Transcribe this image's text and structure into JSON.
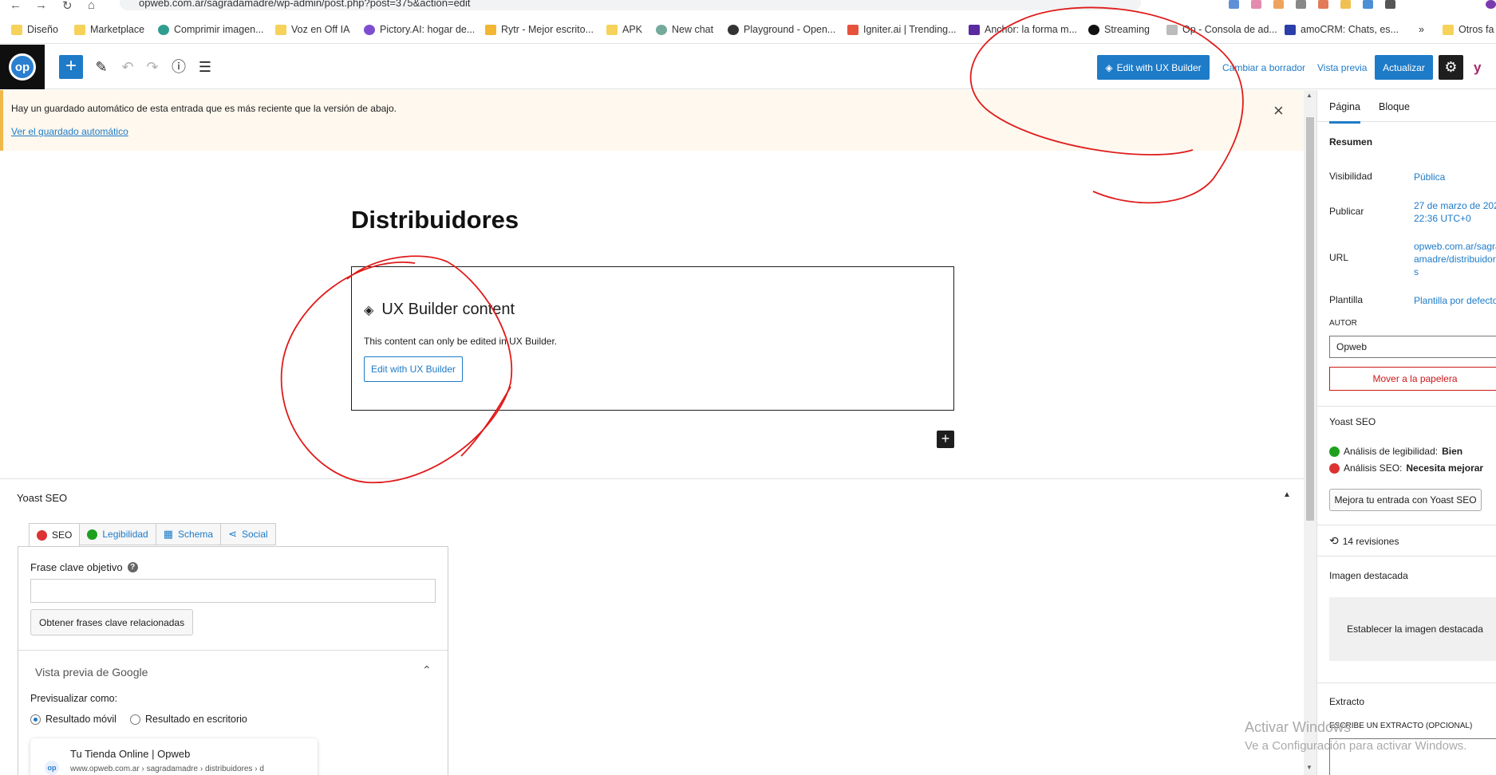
{
  "browser": {
    "url": "opweb.com.ar/sagradamadre/wp-admin/post.php?post=375&action=edit",
    "bookmarks": [
      {
        "label": "Diseño",
        "icon": "folder-icon"
      },
      {
        "label": "Marketplace",
        "icon": "folder-icon"
      },
      {
        "label": "Comprimir imagen...",
        "icon": "leaf-icon"
      },
      {
        "label": "Voz en Off IA",
        "icon": "folder-icon"
      },
      {
        "label": "Pictory.AI: hogar de...",
        "icon": "pictory-icon"
      },
      {
        "label": "Rytr - Mejor escrito...",
        "icon": "rytr-icon"
      },
      {
        "label": "APK",
        "icon": "folder-icon"
      },
      {
        "label": "New chat",
        "icon": "openai-icon"
      },
      {
        "label": "Playground - Open...",
        "icon": "openai-icon"
      },
      {
        "label": "Igniter.ai | Trending...",
        "icon": "igniter-icon"
      },
      {
        "label": "Anchor: la forma m...",
        "icon": "anchor-icon"
      },
      {
        "label": "Streaming",
        "icon": "streaming-icon"
      },
      {
        "label": "Op - Consola de ad...",
        "icon": "op-icon"
      },
      {
        "label": "amoCRM: Chats, es...",
        "icon": "amocrm-icon"
      },
      {
        "label": "»",
        "icon": "overflow-icon"
      },
      {
        "label": "Otros fa",
        "icon": "folder-icon"
      }
    ]
  },
  "toolbar": {
    "ux_builder_label": "Edit with UX Builder",
    "switch_draft_label": "Cambiar a borrador",
    "preview_label": "Vista previa",
    "update_label": "Actualizar",
    "logo_text": "op"
  },
  "notice": {
    "message": "Hay un guardado automático de esta entrada que es más reciente que la versión de abajo.",
    "link": "Ver el guardado automático"
  },
  "editor": {
    "title": "Distribuidores",
    "block": {
      "heading": "UX Builder content",
      "description": "This content can only be edited in UX Builder.",
      "button": "Edit with UX Builder"
    }
  },
  "yoast": {
    "box_title": "Yoast SEO",
    "tabs": [
      {
        "label": "SEO",
        "icon": "red-dot-icon"
      },
      {
        "label": "Legibilidad",
        "icon": "smiley-icon"
      },
      {
        "label": "Schema",
        "icon": "grid-icon"
      },
      {
        "label": "Social",
        "icon": "share-icon"
      }
    ],
    "focus_label": "Frase clave objetivo",
    "related_button": "Obtener frases clave relacionadas",
    "google_preview": "Vista previa de Google",
    "preview_as": "Previsualizar como:",
    "mobile_result": "Resultado móvil",
    "desktop_result": "Resultado en escritorio",
    "snippet_title": "Tu Tienda Online | Opweb",
    "snippet_url": "www.opweb.com.ar › sagradamadre › distribuidores › d"
  },
  "sidebar": {
    "tab_page": "Página",
    "tab_block": "Bloque",
    "summary": "Resumen",
    "visibility_label": "Visibilidad",
    "visibility_value": "Pública",
    "publish_label": "Publicar",
    "publish_value_1": "27 de marzo de 202",
    "publish_value_2": "22:36 UTC+0",
    "url_label": "URL",
    "url_value_1": "opweb.com.ar/sagra",
    "url_value_2": "amadre/distribuidor",
    "url_value_3": "s",
    "template_label": "Plantilla",
    "template_value": "Plantilla por defecto",
    "author_label": "AUTOR",
    "author_value": "Opweb",
    "trash": "Mover a la papelera",
    "yoast_title": "Yoast SEO",
    "readability_label": "Análisis de legibilidad:",
    "readability_value": "Bien",
    "seo_label": "Análisis SEO:",
    "seo_value": "Necesita mejorar",
    "improve_button": "Mejora tu entrada con Yoast SEO",
    "revisions": "14 revisiones",
    "featured_title": "Imagen destacada",
    "featured_button": "Establecer la imagen destacada",
    "excerpt_title": "Extracto",
    "excerpt_label": "ESCRIBE UN EXTRACTO (OPCIONAL)"
  },
  "watermark": {
    "line1": "Activar Windows",
    "line2": "Ve a Configuración para activar Windows."
  },
  "colors": {
    "accent": "#1e7bc8",
    "notice_bg": "#fef8ee",
    "annotation": "#e01b1b",
    "danger": "#cc1818"
  }
}
